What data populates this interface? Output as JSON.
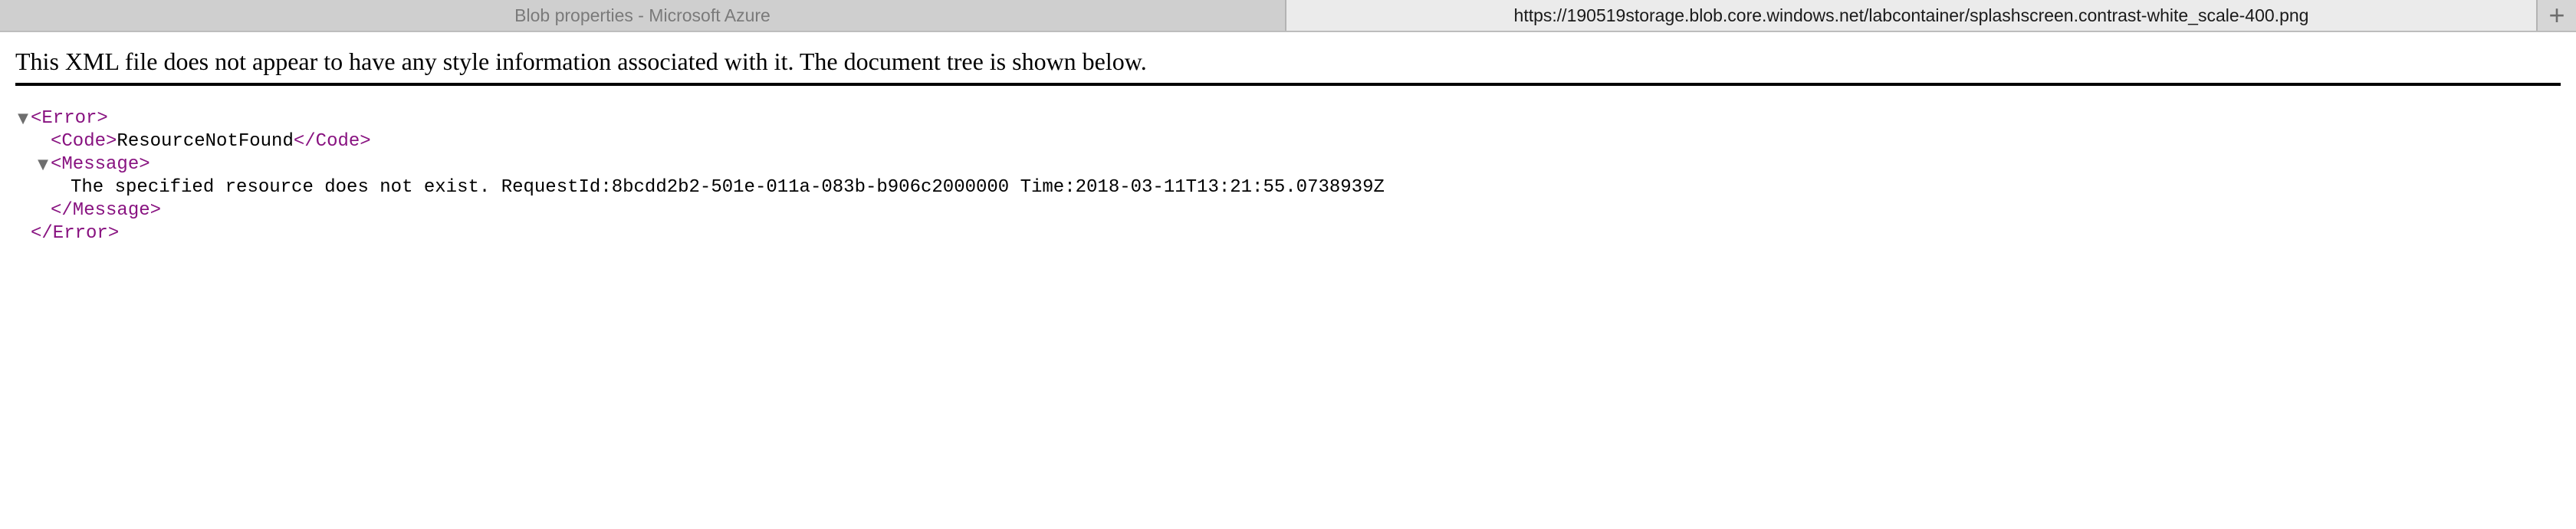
{
  "tabs": [
    {
      "title": "Blob properties - Microsoft Azure",
      "active": false
    },
    {
      "title": "https://190519storage.blob.core.windows.net/labcontainer/splashscreen.contrast-white_scale-400.png",
      "active": true
    }
  ],
  "new_tab": {
    "label": "+",
    "icon": "plus-icon"
  },
  "notice": "This XML file does not appear to have any style information associated with it. The document tree is shown below.",
  "xml": {
    "toggle_glyph": "▼",
    "error_open": "<Error>",
    "error_close": "</Error>",
    "code_open": "<Code>",
    "code_value": "ResourceNotFound",
    "code_close": "</Code>",
    "message_open": "<Message>",
    "message_value": "The specified resource does not exist. RequestId:8bcdd2b2-501e-011a-083b-b906c2000000 Time:2018-03-11T13:21:55.0738939Z",
    "message_close": "</Message>"
  },
  "colors": {
    "tag": "#881280",
    "text": "#000000",
    "tabbar": "#d3d3d3",
    "active_tab": "#ebebeb"
  }
}
